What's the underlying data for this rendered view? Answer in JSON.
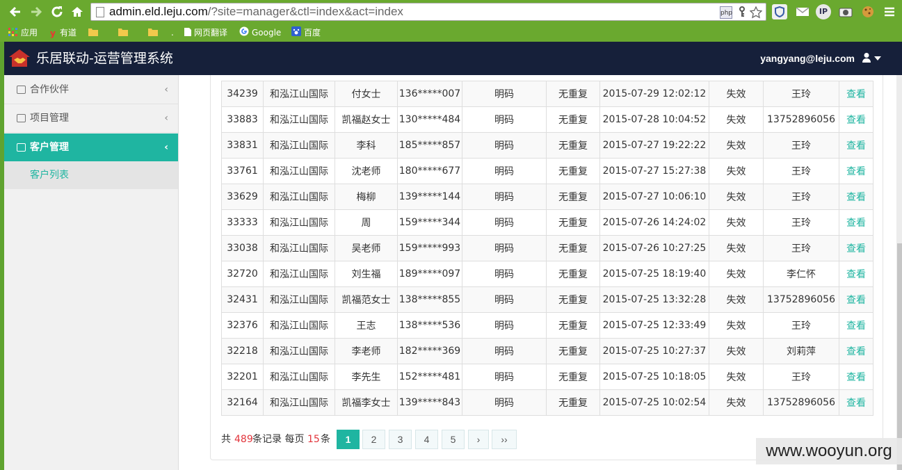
{
  "browser": {
    "url_host": "admin.eld.leju.com",
    "url_rest": "/?site=manager&ctl=index&act=index",
    "bookmarks": [
      "应用",
      "有道",
      "网页翻译",
      "Google",
      "百度"
    ],
    "ext_labels": [
      "php",
      "IP"
    ]
  },
  "header": {
    "title": "乐居联动-运营管理系统",
    "user_email": "yangyang@leju.com",
    "accent_color": "#1fb5a1",
    "bar_color": "#16203a"
  },
  "sidebar": {
    "items": [
      {
        "label": "合作伙伴",
        "icon": "partner-icon"
      },
      {
        "label": "项目管理",
        "icon": "edit-icon"
      },
      {
        "label": "客户管理",
        "icon": "chart-icon"
      }
    ],
    "sub_items": [
      {
        "label": "客户列表"
      }
    ]
  },
  "table": {
    "rows": [
      [
        "34239",
        "和泓江山国际",
        "付女士",
        "136*****007",
        "明码",
        "无重复",
        "2015-07-29 12:02:12",
        "失效",
        "王玲",
        "查看"
      ],
      [
        "33883",
        "和泓江山国际",
        "凯福赵女士",
        "130*****484",
        "明码",
        "无重复",
        "2015-07-28 10:04:52",
        "失效",
        "13752896056",
        "查看"
      ],
      [
        "33831",
        "和泓江山国际",
        "李科",
        "185*****857",
        "明码",
        "无重复",
        "2015-07-27 19:22:22",
        "失效",
        "王玲",
        "查看"
      ],
      [
        "33761",
        "和泓江山国际",
        "沈老师",
        "180*****677",
        "明码",
        "无重复",
        "2015-07-27 15:27:38",
        "失效",
        "王玲",
        "查看"
      ],
      [
        "33629",
        "和泓江山国际",
        "梅柳",
        "139*****144",
        "明码",
        "无重复",
        "2015-07-27 10:06:10",
        "失效",
        "王玲",
        "查看"
      ],
      [
        "33333",
        "和泓江山国际",
        "周",
        "159*****344",
        "明码",
        "无重复",
        "2015-07-26 14:24:02",
        "失效",
        "王玲",
        "查看"
      ],
      [
        "33038",
        "和泓江山国际",
        "吴老师",
        "159*****993",
        "明码",
        "无重复",
        "2015-07-26 10:27:25",
        "失效",
        "王玲",
        "查看"
      ],
      [
        "32720",
        "和泓江山国际",
        "刘生福",
        "189*****097",
        "明码",
        "无重复",
        "2015-07-25 18:19:40",
        "失效",
        "李仁怀",
        "查看"
      ],
      [
        "32431",
        "和泓江山国际",
        "凯福范女士",
        "138*****855",
        "明码",
        "无重复",
        "2015-07-25 13:32:28",
        "失效",
        "13752896056",
        "查看"
      ],
      [
        "32376",
        "和泓江山国际",
        "王志",
        "138*****536",
        "明码",
        "无重复",
        "2015-07-25 12:33:49",
        "失效",
        "王玲",
        "查看"
      ],
      [
        "32218",
        "和泓江山国际",
        "李老师",
        "182*****369",
        "明码",
        "无重复",
        "2015-07-25 10:27:37",
        "失效",
        "刘莉萍",
        "查看"
      ],
      [
        "32201",
        "和泓江山国际",
        "李先生",
        "152*****481",
        "明码",
        "无重复",
        "2015-07-25 10:18:05",
        "失效",
        "王玲",
        "查看"
      ],
      [
        "32164",
        "和泓江山国际",
        "凯福李女士",
        "139*****843",
        "明码",
        "无重复",
        "2015-07-25 10:02:54",
        "失效",
        "13752896056",
        "查看"
      ]
    ]
  },
  "pagination": {
    "prefix": "共",
    "total": "489",
    "mid": "条记录 每页",
    "per_page": "15",
    "suffix": "条",
    "pages": [
      "1",
      "2",
      "3",
      "4",
      "5"
    ],
    "next": "›",
    "last": "››",
    "current": "1"
  },
  "watermark": "www.wooyun.org"
}
